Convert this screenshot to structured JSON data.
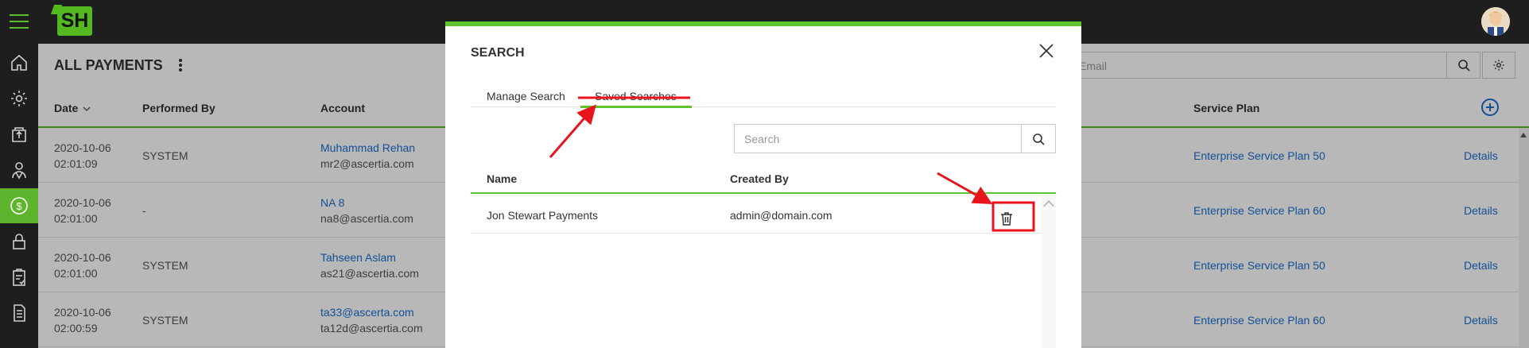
{
  "app": {
    "logo_text": "SH"
  },
  "page": {
    "title": "ALL PAYMENTS"
  },
  "top_search": {
    "placeholder": "Email"
  },
  "table": {
    "columns": [
      "Date",
      "Performed By",
      "Account",
      "Service Plan"
    ],
    "sort_indicator": "chevron-down-icon",
    "rows": [
      {
        "date": "2020-10-06",
        "time": "02:01:09",
        "performed_by": "SYSTEM",
        "account_name": "Muhammad Rehan",
        "account_email": "mr2@ascertia.com",
        "service_plan": "Enterprise Service Plan 50",
        "action": "Details"
      },
      {
        "date": "2020-10-06",
        "time": "02:01:00",
        "performed_by": "-",
        "account_name": "NA 8",
        "account_email": "na8@ascertia.com",
        "service_plan": "Enterprise Service Plan 60",
        "action": "Details"
      },
      {
        "date": "2020-10-06",
        "time": "02:01:00",
        "performed_by": "SYSTEM",
        "account_name": "Tahseen Aslam",
        "account_email": "as21@ascertia.com",
        "service_plan": "Enterprise Service Plan 50",
        "action": "Details"
      },
      {
        "date": "2020-10-06",
        "time": "02:00:59",
        "performed_by": "SYSTEM",
        "account_name": "ta33@ascerta.com",
        "account_email": "ta12d@ascertia.com",
        "service_plan": "Enterprise Service Plan 60",
        "action": "Details"
      }
    ]
  },
  "modal": {
    "title": "SEARCH",
    "tabs": [
      {
        "label": "Manage Search"
      },
      {
        "label": "Saved Searches"
      }
    ],
    "active_tab": "Saved Searches",
    "search": {
      "placeholder": "Search"
    },
    "columns": [
      "Name",
      "Created By"
    ],
    "rows": [
      {
        "name": "Jon Stewart Payments",
        "created_by": "admin@domain.com"
      }
    ]
  },
  "colors": {
    "accent_green": "#5cc42c",
    "link_blue": "#1a6fd0",
    "annotation_red": "#e8141c",
    "topbar": "#1e1e1e"
  }
}
